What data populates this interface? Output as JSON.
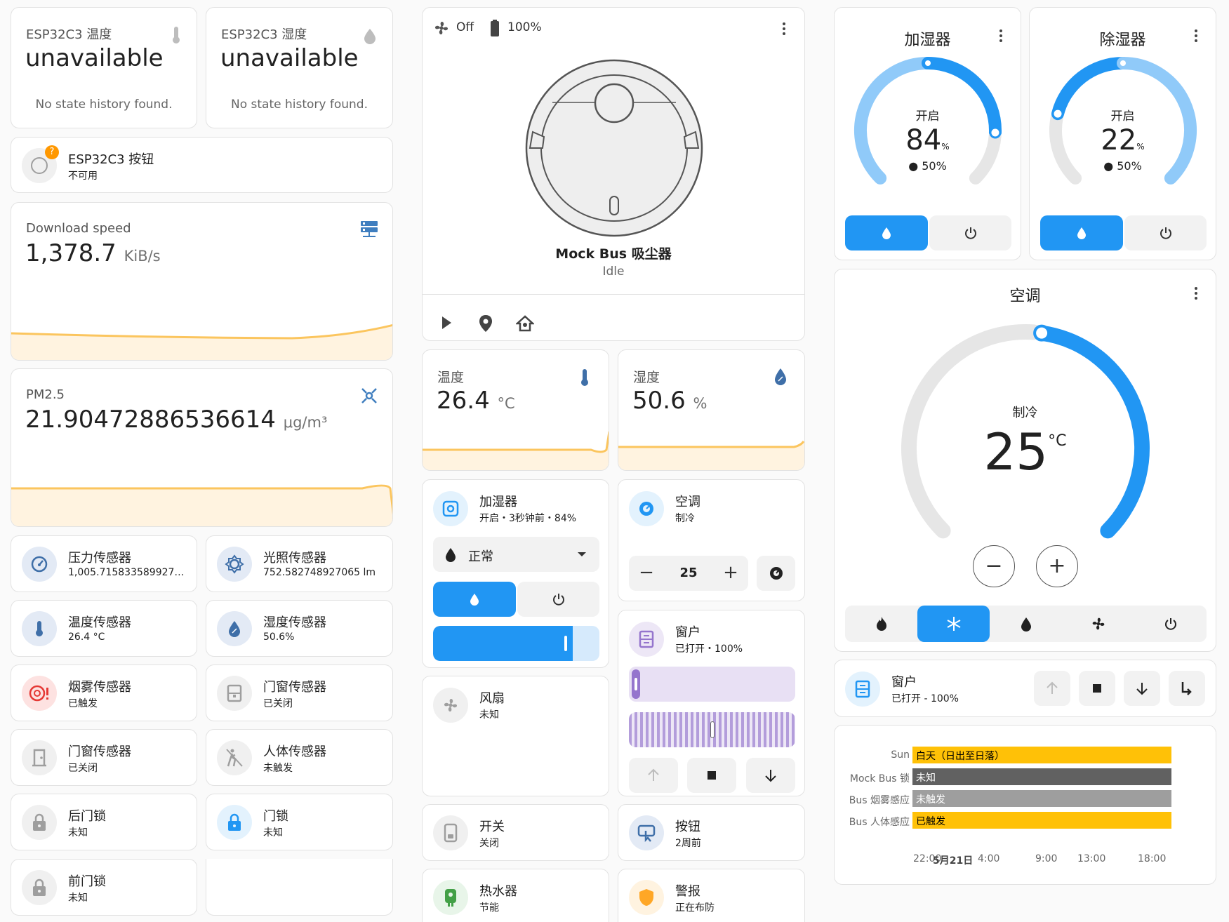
{
  "esp_temp": {
    "name": "ESP32C3 温度",
    "value": "unavailable",
    "note": "No state history found."
  },
  "esp_hum": {
    "name": "ESP32C3 湿度",
    "value": "unavailable",
    "note": "No state history found."
  },
  "esp_button": {
    "name": "ESP32C3 按钮",
    "state": "不可用",
    "badge": "?"
  },
  "download": {
    "title": "Download speed",
    "value": "1,378.7",
    "unit": "KiB/s"
  },
  "pm25": {
    "title": "PM2.5",
    "value": "21.90472886536614",
    "unit": "μg/m³"
  },
  "tiles_left": [
    {
      "name": "压力传感器",
      "state": "1,005.7158335899276…",
      "icon": "gauge-icon"
    },
    {
      "name": "光照传感器",
      "state": "752.582748927065 lm",
      "icon": "brightness-icon"
    },
    {
      "name": "温度传感器",
      "state": "26.4 °C",
      "icon": "thermometer-icon"
    },
    {
      "name": "湿度传感器",
      "state": "50.6%",
      "icon": "water-percent-icon"
    },
    {
      "name": "烟雾传感器",
      "state": "已触发",
      "icon": "smoke-detector-alert-icon"
    },
    {
      "name": "门窗传感器",
      "state": "已关闭",
      "icon": "window-closed-icon"
    },
    {
      "name": "门窗传感器",
      "state": "已关闭",
      "icon": "door-closed-icon"
    },
    {
      "name": "人体传感器",
      "state": "未触发",
      "icon": "motion-sensor-off-icon"
    },
    {
      "name": "后门锁",
      "state": "未知",
      "icon": "lock-icon"
    },
    {
      "name": "门锁",
      "state": "未知",
      "icon": "lock-icon"
    },
    {
      "name": "前门锁",
      "state": "未知",
      "icon": "lock-icon"
    }
  ],
  "vacuum": {
    "fan": "Off",
    "battery": "100%",
    "name": "Mock Bus 吸尘器",
    "status": "Idle"
  },
  "temp_card": {
    "title": "温度",
    "value": "26.4",
    "unit": "°C"
  },
  "hum_card": {
    "title": "湿度",
    "value": "50.6",
    "unit": "%"
  },
  "humidifier_tile": {
    "name": "加湿器",
    "state": "开启・3秒钟前・84%",
    "mode": "正常",
    "target_fraction": 0.84
  },
  "climate_tile": {
    "name": "空调",
    "state": "制冷",
    "target": "25"
  },
  "fan_tile": {
    "name": "风扇",
    "state": "未知"
  },
  "cover_tile": {
    "name": "窗户",
    "state": "已打开・100%",
    "position_fraction": 0.0,
    "tilt_fraction": 0.5
  },
  "switch_tile": {
    "name": "开关",
    "state": "关闭"
  },
  "button_tile": {
    "name": "按钮",
    "state": "2周前"
  },
  "water_heater_tile": {
    "name": "热水器",
    "state": "节能"
  },
  "alarm_tile": {
    "name": "警报",
    "state": "正在布防"
  },
  "humidifier_gauge": {
    "title": "加湿器",
    "mode": "开启",
    "value": "84",
    "unit": "%",
    "current": "50%",
    "fraction": 0.84
  },
  "dehumidifier_gauge": {
    "title": "除湿器",
    "mode": "开启",
    "value": "22",
    "unit": "%",
    "current": "50%",
    "fraction": 0.22
  },
  "ac_card": {
    "title": "空调",
    "mode": "制冷",
    "value": "25",
    "unit": "°C",
    "fraction": 0.5
  },
  "window_card": {
    "name": "窗户",
    "state": "已打开 - 100%"
  },
  "colors": {
    "primary": "#2196f3",
    "primary_light": "#90caf9",
    "amber": "#ffc107",
    "chart_line": "#fbc55e",
    "chart_fill": "#fff3e0"
  },
  "timeline": {
    "rows": [
      {
        "label": "Sun",
        "segments": [
          {
            "text": "白天（日出至日落）",
            "color": "#ffc107"
          }
        ]
      },
      {
        "label": "Mock Bus 锁",
        "segments": [
          {
            "text": "未知",
            "color": "#616161"
          }
        ]
      },
      {
        "label": "Bus 烟雾感应",
        "segments": [
          {
            "text": "未触发",
            "color": "#9e9e9e"
          }
        ]
      },
      {
        "label": "Bus 人体感应",
        "segments": [
          {
            "text": "已触发",
            "color": "#ffc107"
          }
        ]
      }
    ],
    "ticks": [
      "22:00",
      "5月21日",
      "4:00",
      "9:00",
      "13:00",
      "18:00"
    ]
  }
}
